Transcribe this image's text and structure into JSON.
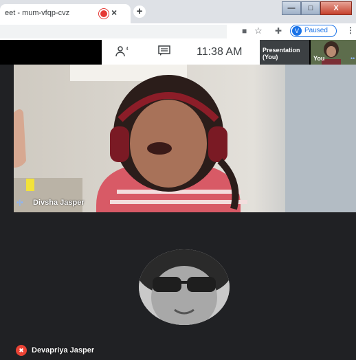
{
  "browser": {
    "tab_title": "eet - mum-vfqp-cvz",
    "tab_close": "×",
    "new_tab": "+",
    "window_min": "—",
    "window_max": "□",
    "window_close": "X",
    "profile_initial": "V",
    "profile_status": "Paused"
  },
  "meet": {
    "time": "11:38 AM",
    "presentation_label_1": "Presentation",
    "presentation_label_2": "(You)",
    "you_label": "You"
  },
  "participants": {
    "main_name": "Divsha Jasper",
    "second_name": "Devapriya Jasper"
  },
  "colors": {
    "record": "#e53935",
    "profile_accent": "#1a73e8",
    "mute": "#ea4335",
    "meet_bg": "#202124"
  },
  "icons": [
    "record-icon",
    "camera-icon",
    "star-icon",
    "extensions-icon",
    "more-icon",
    "people-icon",
    "chat-icon",
    "mic-off-icon",
    "audio-level-icon"
  ]
}
